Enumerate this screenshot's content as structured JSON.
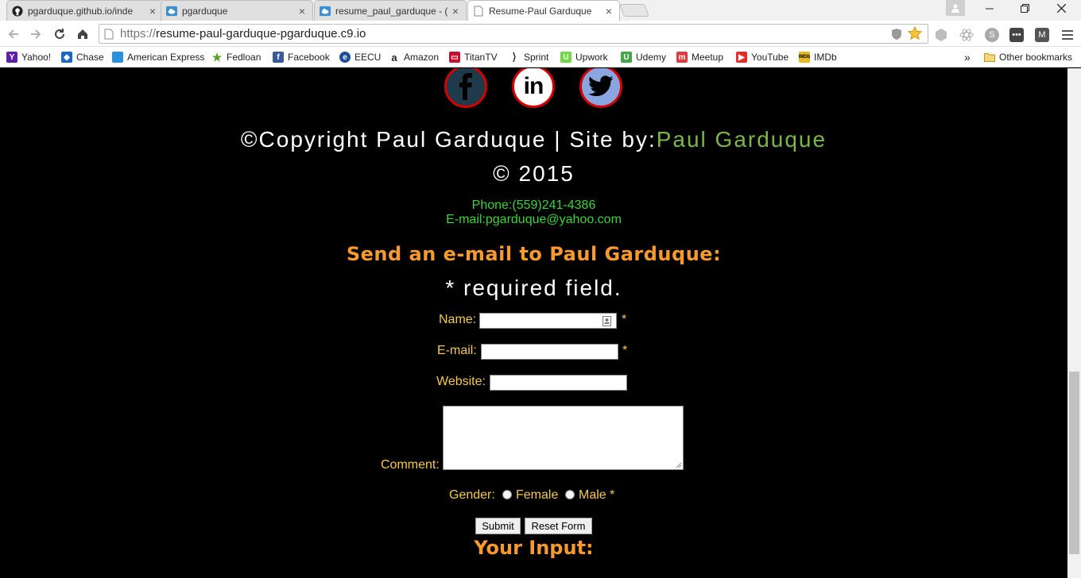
{
  "browser": {
    "tabs": [
      {
        "title": "pgarduque.github.io/inde",
        "icon": "github-icon",
        "active": false
      },
      {
        "title": "pgarduque",
        "icon": "cloud9-icon",
        "active": false
      },
      {
        "title": "resume_paul_garduque - (",
        "icon": "cloud9-icon",
        "active": false
      },
      {
        "title": "Resume-Paul Garduque",
        "icon": "page-icon",
        "active": true
      }
    ],
    "tab_close": "×",
    "url_scheme": "https://",
    "url_host": "resume-paul-garduque-pgarduque.c9.io",
    "bookmarks": [
      {
        "label": "Yahoo!",
        "icon": "yahoo-icon",
        "color": "#5f1fa8"
      },
      {
        "label": "Chase",
        "icon": "chase-icon",
        "color": "#1769c4"
      },
      {
        "label": "American Express",
        "icon": "amex-icon",
        "color": "#2a8fdc"
      },
      {
        "label": "Fedloan",
        "icon": "fedloan-icon",
        "color": "#5aa02c"
      },
      {
        "label": "Facebook",
        "icon": "facebook-icon",
        "color": "#3b5998"
      },
      {
        "label": "EECU",
        "icon": "eecu-icon",
        "color": "#1d4f9c"
      },
      {
        "label": "Amazon",
        "icon": "amazon-icon",
        "color": "#222222"
      },
      {
        "label": "TitanTV",
        "icon": "titantv-icon",
        "color": "#c8102e"
      },
      {
        "label": "Sprint",
        "icon": "sprint-icon",
        "color": "#333333"
      },
      {
        "label": "Upwork",
        "icon": "upwork-icon",
        "color": "#6fda44"
      },
      {
        "label": "Udemy",
        "icon": "udemy-icon",
        "color": "#44a84a"
      },
      {
        "label": "Meetup",
        "icon": "meetup-icon",
        "color": "#e0393e"
      },
      {
        "label": "YouTube",
        "icon": "youtube-icon",
        "color": "#e52d27"
      },
      {
        "label": "IMDb",
        "icon": "imdb-icon",
        "color": "#e6b91e"
      }
    ],
    "bookmarks_overflow": "»",
    "other_bookmarks": "Other bookmarks"
  },
  "footer": {
    "social": [
      {
        "name": "facebook",
        "glyph": "f"
      },
      {
        "name": "linkedin",
        "glyph": "in"
      },
      {
        "name": "twitter",
        "glyph": "twitter-bird"
      }
    ],
    "copyright_prefix": "©Copyright Paul Garduque | Site by:",
    "copyright_author": "Paul Garduque",
    "copyright_year": "© 2015",
    "phone": "Phone:(559)241-4386",
    "email": "E-mail:pgarduque@yahoo.com"
  },
  "form": {
    "heading": "Send an e-mail to Paul Garduque:",
    "required_note": "* required field.",
    "name_label": "Name:",
    "email_label": "E-mail:",
    "website_label": "Website:",
    "comment_label": "Comment:",
    "gender_label": "Gender:",
    "female_label": "Female",
    "male_label": "Male",
    "required_marker": "*",
    "submit_label": "Submit",
    "reset_label": "Reset Form",
    "your_input_heading": "Your Input:"
  },
  "colors": {
    "page_background": "#000000",
    "heading_orange": "#f79a2e",
    "label_yellow": "#f6c94d",
    "contact_green": "#3ad33a",
    "author_green": "#7ab648",
    "social_border_red": "#d40000"
  }
}
